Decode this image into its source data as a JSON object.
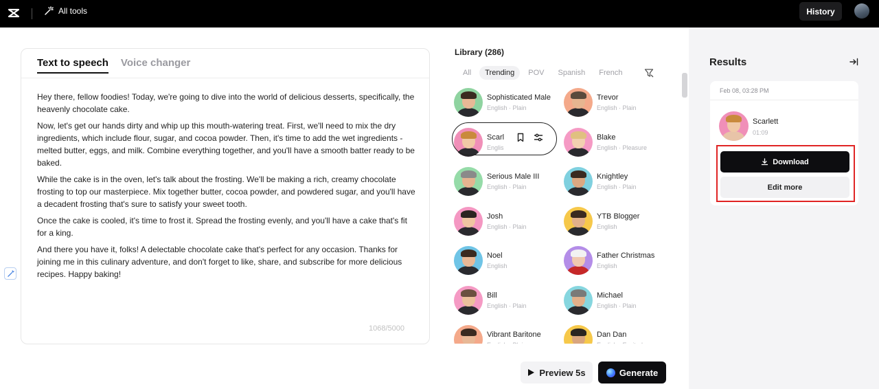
{
  "topbar": {
    "all_tools_label": "All tools",
    "history_label": "History"
  },
  "editor": {
    "tabs": [
      {
        "label": "Text to speech",
        "active": true
      },
      {
        "label": "Voice changer",
        "active": false
      }
    ],
    "paragraphs": [
      "Hey there, fellow foodies! Today, we're going to dive into the world of delicious desserts, specifically, the heavenly chocolate cake.",
      "Now, let's get our hands dirty and whip up this mouth-watering treat. First, we'll need to mix the dry ingredients, which include flour, sugar, and cocoa powder. Then, it's time to add the wet ingredients - melted butter, eggs, and milk. Combine everything together, and you'll have a smooth batter ready to be baked.",
      "While the cake is in the oven, let's talk about the frosting. We'll be making a rich, creamy chocolate frosting to top our masterpiece. Mix together butter, cocoa powder, and powdered sugar, and you'll have a decadent frosting that's sure to satisfy your sweet tooth.",
      "Once the cake is cooled, it's time to frost it. Spread the frosting evenly, and you'll have a cake that's fit for a king.",
      "And there you have it, folks! A delectable chocolate cake that's perfect for any occasion. Thanks for joining me in this culinary adventure, and don't forget to like, share, and subscribe for more delicious recipes. Happy baking!"
    ],
    "char_count": "1068/5000"
  },
  "library": {
    "title": "Library (286)",
    "filters": [
      "All",
      "Trending",
      "POV",
      "Spanish",
      "French"
    ],
    "active_filter": "Trending",
    "voices": [
      {
        "name": "Sophisticated Male",
        "meta": "English · Plain",
        "bg": "#8fd3a0"
      },
      {
        "name": "Trevor",
        "meta": "English · Plain",
        "bg": "#f4a98a"
      },
      {
        "name": "Scarlett",
        "meta": "English",
        "bg": "#f08fb8"
      },
      {
        "name": "Blake",
        "meta": "English · Pleasure",
        "bg": "#f59ac4"
      },
      {
        "name": "Serious Male III",
        "meta": "English · Plain",
        "bg": "#95dba8"
      },
      {
        "name": "Knightley",
        "meta": "English · Plain",
        "bg": "#7fd0df"
      },
      {
        "name": "Josh",
        "meta": "English · Plain",
        "bg": "#f497c2"
      },
      {
        "name": "YTB Blogger",
        "meta": "English",
        "bg": "#f6c84a"
      },
      {
        "name": "Noel",
        "meta": "English",
        "bg": "#6fc4e6"
      },
      {
        "name": "Father Christmas",
        "meta": "English",
        "bg": "#b48de8"
      },
      {
        "name": "Bill",
        "meta": "English · Plain",
        "bg": "#f59ac4"
      },
      {
        "name": "Michael",
        "meta": "English · Plain",
        "bg": "#86d6df"
      },
      {
        "name": "Vibrant Baritone",
        "meta": "English · Plain",
        "bg": "#f4a98a"
      },
      {
        "name": "Dan Dan",
        "meta": "English · Excited",
        "bg": "#f6c84a"
      }
    ],
    "selected_short_name": "Scarl",
    "selected_short_meta": "Englis"
  },
  "actions": {
    "preview_label": "Preview 5s",
    "generate_label": "Generate"
  },
  "results": {
    "title": "Results",
    "date": "Feb 08, 03:28 PM",
    "voice_name": "Scarlett",
    "duration": "01:09",
    "download_label": "Download",
    "edit_more_label": "Edit more"
  }
}
